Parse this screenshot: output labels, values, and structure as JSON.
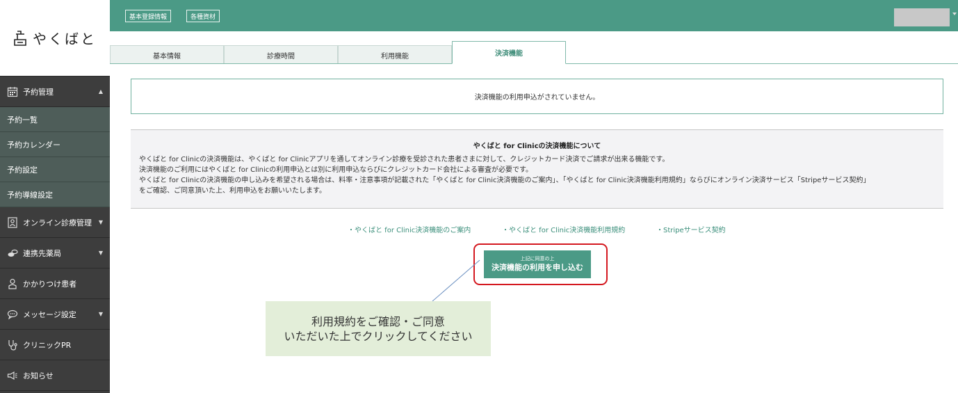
{
  "app": {
    "logo_text": "やくばと"
  },
  "topbar": {
    "buttons": [
      "基本登録情報",
      "各種資材"
    ]
  },
  "sidebar": {
    "sections": [
      {
        "label": "予約管理",
        "icon": "calendar-icon",
        "caret": "▲"
      },
      {
        "label": "オンライン診療管理",
        "icon": "doctor-icon",
        "caret": "▼"
      },
      {
        "label": "連携先薬局",
        "icon": "pharmacy-icon",
        "caret": "▼"
      },
      {
        "label": "かかりつけ患者",
        "icon": "person-icon"
      },
      {
        "label": "メッセージ設定",
        "icon": "chat-icon",
        "caret": "▼"
      },
      {
        "label": "クリニックPR",
        "icon": "stethoscope-icon"
      },
      {
        "label": "お知らせ",
        "icon": "megaphone-icon"
      }
    ],
    "reservation_items": [
      "予約一覧",
      "予約カレンダー",
      "予約設定",
      "予約導線設定"
    ]
  },
  "tabs": [
    {
      "label": "基本情報"
    },
    {
      "label": "診療時間"
    },
    {
      "label": "利用機能"
    },
    {
      "label": "決済機能",
      "active": true
    }
  ],
  "notice": {
    "text": "決済機能の利用申込がされていません。"
  },
  "about": {
    "title": "やくばと for Clinicの決済機能について",
    "lines": [
      "やくばと for Clinicの決済機能は、やくばと for Clinicアプリを通してオンライン診療を受診された患者さまに対して、クレジットカード決済でご請求が出来る機能です。",
      "決済機能のご利用にはやくばと for Clinicの利用申込とは別に利用申込ならびにクレジットカード会社による審査が必要です。",
      "やくばと for Clinicの決済機能の申し込みを希望される場合は、料率・注意事項が記載された「やくばと for Clinic決済機能のご案内」、「やくばと for Clinic決済機能利用規約」ならびにオンライン決済サービス「Stripeサービス契約」",
      "をご確認、ご同意頂いた上、利用申込をお願いいたします。"
    ]
  },
  "links": [
    "・やくばと for Clinic決済機能のご案内",
    "・やくばと for Clinic決済機能利用規約",
    "・Stripeサービス契約"
  ],
  "apply_button": {
    "small": "上記に同意の上",
    "big": "決済機能の利用を申し込む"
  },
  "callout": {
    "line1": "利用規約をご確認・ご同意",
    "line2": "いただいた上でクリックしてください"
  },
  "colors": {
    "brand": "#4b9a86",
    "sidebar": "#3d3d3d",
    "sidebar_sub": "#4e5d59",
    "highlight": "#d4181f",
    "callout_bg": "#e3eed9"
  }
}
